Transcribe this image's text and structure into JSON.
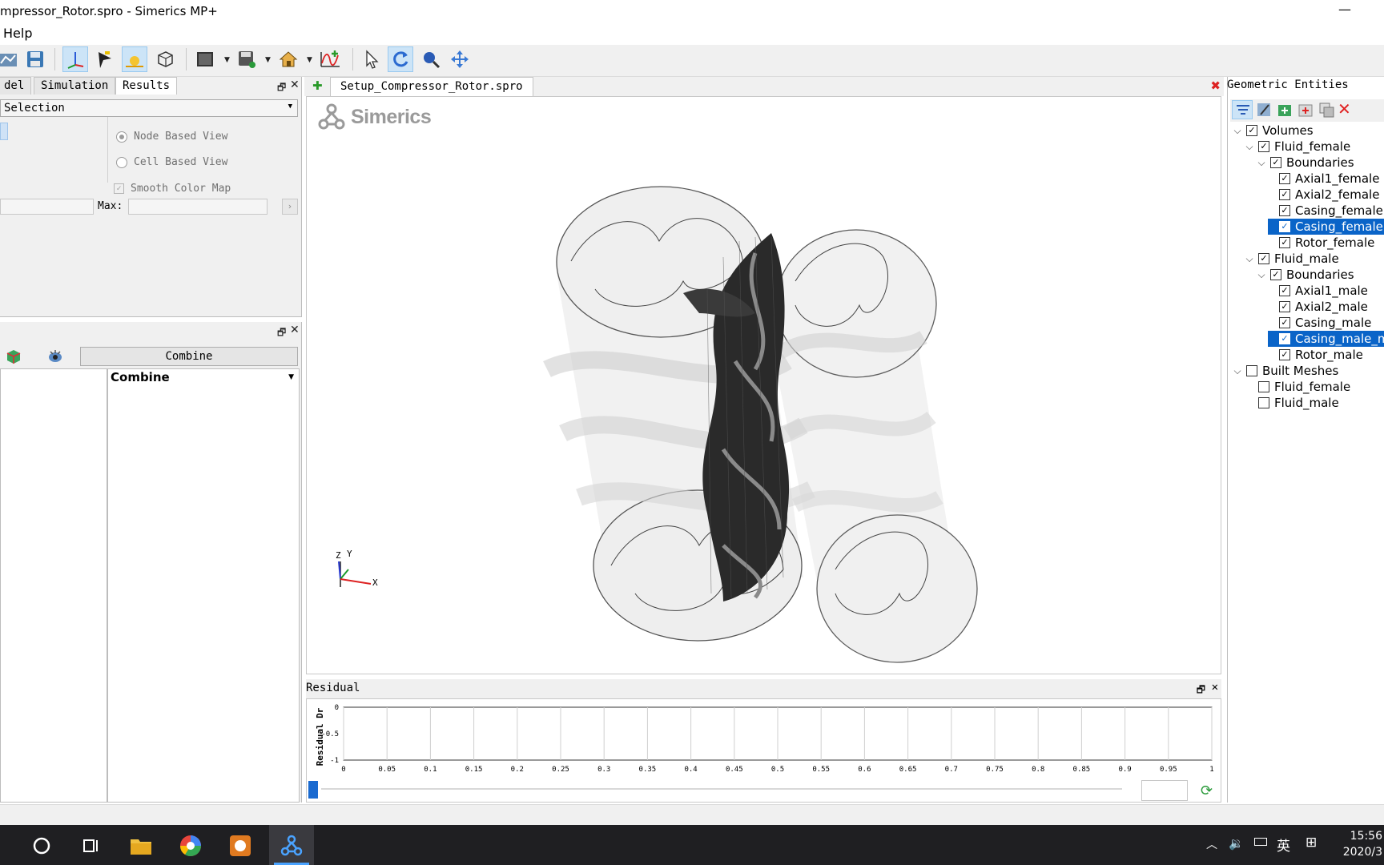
{
  "window": {
    "title": "mpressor_Rotor.spro - Simerics MP+",
    "minimize_glyph": "—"
  },
  "menu": {
    "help": "Help"
  },
  "toolbar": {
    "icons": [
      "chart-icon",
      "save-icon",
      "axes-icon",
      "flag-icon",
      "light-icon",
      "box-icon",
      "display-icon",
      "export-icon",
      "home-icon",
      "graph-icon",
      "pointer-icon",
      "rotate-icon",
      "zoom-icon",
      "pan-icon"
    ]
  },
  "left_panel": {
    "tabs": [
      {
        "label": "del"
      },
      {
        "label": "Simulation"
      },
      {
        "label": "Results"
      }
    ],
    "selection_combo": "Selection",
    "node_based_view": "Node Based View",
    "cell_based_view": "Cell Based View",
    "smooth_color_map": "Smooth Color Map",
    "max_label": "Max:",
    "combine_button": "Combine",
    "combine_column": "Combine"
  },
  "viewport": {
    "doc_tab": "Setup_Compressor_Rotor.spro",
    "brand": "Simerics",
    "axis_labels": {
      "z": "Z",
      "y": "Y",
      "x": "X"
    }
  },
  "residual": {
    "title": "Residual",
    "ylabel": "Residual Dr",
    "y_ticks": [
      "0",
      "-0.5",
      "-1"
    ],
    "x_ticks": [
      "0",
      "0.05",
      "0.1",
      "0.15",
      "0.2",
      "0.25",
      "0.3",
      "0.35",
      "0.4",
      "0.45",
      "0.5",
      "0.55",
      "0.6",
      "0.65",
      "0.7",
      "0.75",
      "0.8",
      "0.85",
      "0.9",
      "0.95",
      "1"
    ]
  },
  "geometric_entities": {
    "title": "Geometric Entities",
    "tree": [
      {
        "label": "Volumes",
        "level": 0,
        "expanded": true,
        "checked": true
      },
      {
        "label": "Fluid_female",
        "level": 1,
        "expanded": true,
        "checked": true
      },
      {
        "label": "Boundaries",
        "level": 2,
        "expanded": true,
        "checked": true
      },
      {
        "label": "Axial1_female",
        "level": 3,
        "checked": true
      },
      {
        "label": "Axial2_female",
        "level": 3,
        "checked": true
      },
      {
        "label": "Casing_female",
        "level": 3,
        "checked": true
      },
      {
        "label": "Casing_female",
        "level": 3,
        "checked": true,
        "selected": true
      },
      {
        "label": "Rotor_female",
        "level": 3,
        "checked": true
      },
      {
        "label": "Fluid_male",
        "level": 1,
        "expanded": true,
        "checked": true
      },
      {
        "label": "Boundaries",
        "level": 2,
        "expanded": true,
        "checked": true
      },
      {
        "label": "Axial1_male",
        "level": 3,
        "checked": true
      },
      {
        "label": "Axial2_male",
        "level": 3,
        "checked": true
      },
      {
        "label": "Casing_male",
        "level": 3,
        "checked": true
      },
      {
        "label": "Casing_male_m",
        "level": 3,
        "checked": true,
        "selected": true
      },
      {
        "label": "Rotor_male",
        "level": 3,
        "checked": true
      },
      {
        "label": "Built Meshes",
        "level": 0,
        "expanded": true,
        "checked": false
      },
      {
        "label": "Fluid_female",
        "level": 1,
        "checked": false
      },
      {
        "label": "Fluid_male",
        "level": 1,
        "checked": false
      }
    ]
  },
  "taskbar": {
    "ime": "英",
    "time": "15:56",
    "date": "2020/3"
  }
}
